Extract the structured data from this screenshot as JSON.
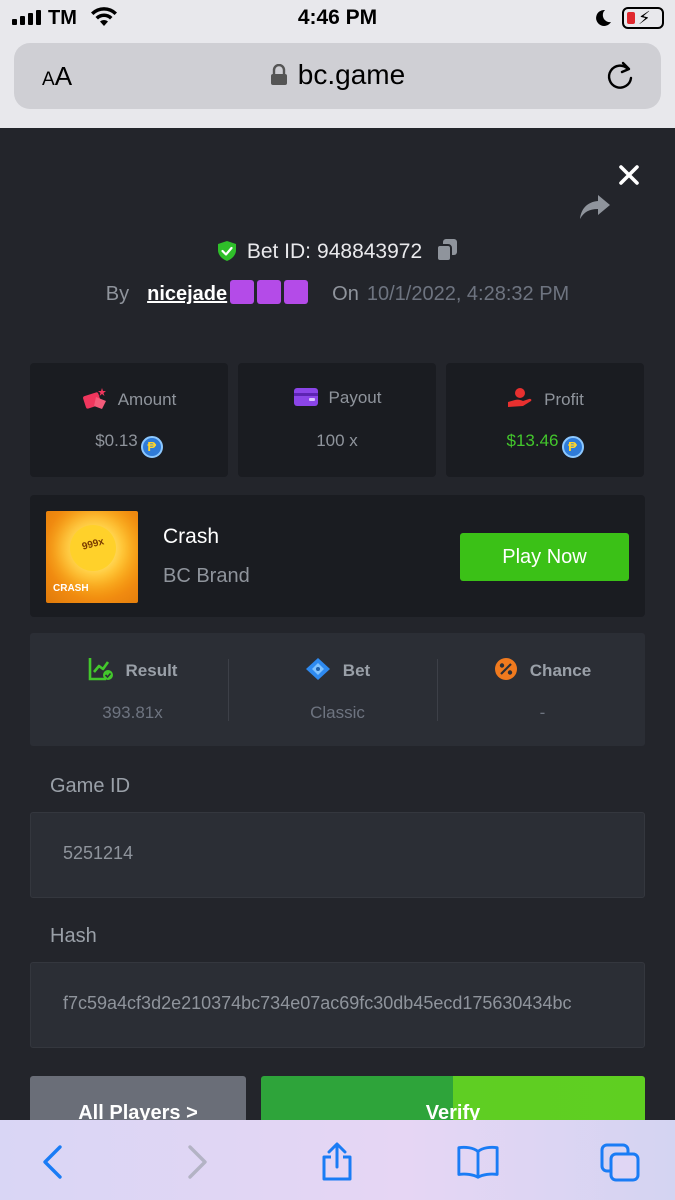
{
  "status_bar": {
    "carrier": "TM",
    "time": "4:46 PM"
  },
  "browser": {
    "text_size_label_small": "A",
    "text_size_label_large": "A",
    "url": "bc.game"
  },
  "bet": {
    "id_label": "Bet ID:",
    "id_value": "948843972",
    "by_label": "By",
    "username": "nicejade",
    "on_label": "On",
    "date": "10/1/2022, 4:28:32 PM"
  },
  "stats": {
    "amount_label": "Amount",
    "amount_value": "$0.13",
    "payout_label": "Payout",
    "payout_value": "100 x",
    "profit_label": "Profit",
    "profit_value": "$13.46",
    "coin_symbol": "₱",
    "profit_color": "#43c72c"
  },
  "game": {
    "thumb_multiplier": "999x",
    "thumb_title": "CRASH",
    "name": "Crash",
    "brand": "BC Brand",
    "play_label": "Play Now",
    "play_color": "#3bc117"
  },
  "details": {
    "result_label": "Result",
    "result_value": "393.81x",
    "bet_label": "Bet",
    "bet_value": "Classic",
    "chance_label": "Chance",
    "chance_value": "-"
  },
  "fields": {
    "game_id_label": "Game ID",
    "game_id_value": "5251214",
    "hash_label": "Hash",
    "hash_value": "f7c59a4cf3d2e210374bc734e07ac69fc30db45ecd175630434bc"
  },
  "actions": {
    "all_players_label": "All Players >",
    "verify_label": "Verify"
  }
}
